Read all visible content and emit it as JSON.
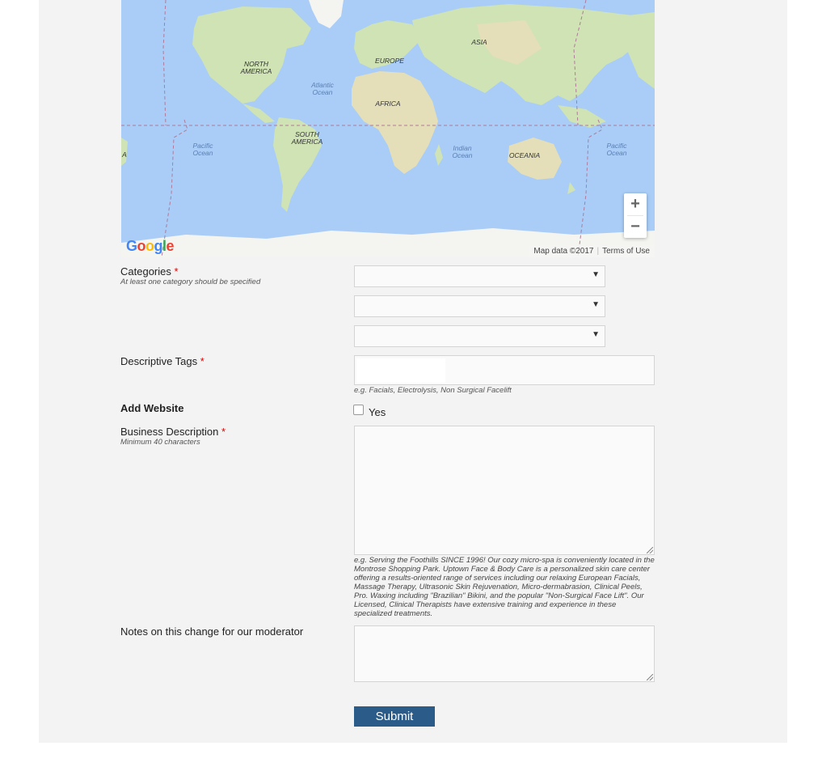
{
  "map": {
    "continents": [
      "NORTH AMERICA",
      "SOUTH AMERICA",
      "EUROPE",
      "AFRICA",
      "ASIA",
      "OCEANIA"
    ],
    "oceans": [
      "Atlantic Ocean",
      "Pacific Ocean",
      "Pacific Ocean",
      "Indian Ocean"
    ],
    "zoom_in": "+",
    "zoom_out": "−",
    "attribution": "Map data ©2017",
    "terms": "Terms of Use",
    "logo": "Google",
    "edge_label": "A"
  },
  "form": {
    "categories": {
      "label": "Categories",
      "required": "*",
      "hint": "At least one category should be specified",
      "selects": [
        {
          "value": ""
        },
        {
          "value": ""
        },
        {
          "value": ""
        }
      ]
    },
    "tags": {
      "label": "Descriptive Tags",
      "required": "*",
      "value": "",
      "hint": "e.g. Facials, Electrolysis, Non Surgical Facelift"
    },
    "website": {
      "label": "Add Website",
      "checkbox_label": "Yes"
    },
    "description": {
      "label": "Business Description",
      "required": "*",
      "hint": "Minimum 40 characters",
      "example": "e.g. Serving the Foothills SINCE 1996! Our cozy micro-spa is conveniently located in the Montrose Shopping Park. Uptown Face & Body Care is a personalized skin care center offering a results-oriented range of services including our relaxing European Facials, Massage Therapy, Ultrasonic Skin Rejuvenation, Micro-dermabrasion, Clinical Peels, Pro. Waxing including \"Brazilian\" Bikini, and the popular \"Non-Surgical Face Lift\". Our Licensed, Clinical Therapists have extensive training and experience in these specialized treatments."
    },
    "notes": {
      "label": "Notes on this change for our moderator"
    },
    "submit_label": "Submit"
  },
  "colors": {
    "submit_bg": "#2b5b88",
    "required": "#dd0000",
    "ocean": "#a9cdf7",
    "land": "#cfe3b4"
  }
}
